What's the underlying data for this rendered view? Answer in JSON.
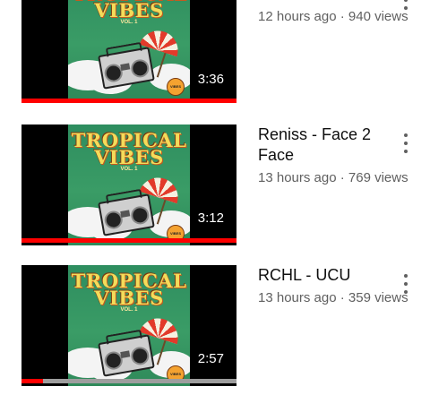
{
  "colors": {
    "progress_played": "#ff0000",
    "progress_track": "#9e9e9e",
    "meta_text": "#606060",
    "title_text": "#0f0f0f"
  },
  "videos": [
    {
      "title": "",
      "meta": "12 hours ago · 940 views",
      "duration": "3:36",
      "thumbnail_text": "TROPICAL VIBES",
      "thumbnail_sub": "VOL. 1",
      "watch_progress": 1.0,
      "menu_icon": "more-vert-icon"
    },
    {
      "title": "Reniss - Face 2 Face",
      "meta": "13 hours ago · 769 views",
      "duration": "3:12",
      "thumbnail_text": "TROPICAL VIBES",
      "thumbnail_sub": "VOL. 1",
      "watch_progress": 1.0,
      "menu_icon": "more-vert-icon"
    },
    {
      "title": "RCHL - UCU",
      "meta": "13 hours ago · 359 views",
      "duration": "2:57",
      "thumbnail_text": "TROPICAL VIBES",
      "thumbnail_sub": "VOL. 1",
      "watch_progress": 0.1,
      "menu_icon": "more-vert-icon"
    }
  ]
}
